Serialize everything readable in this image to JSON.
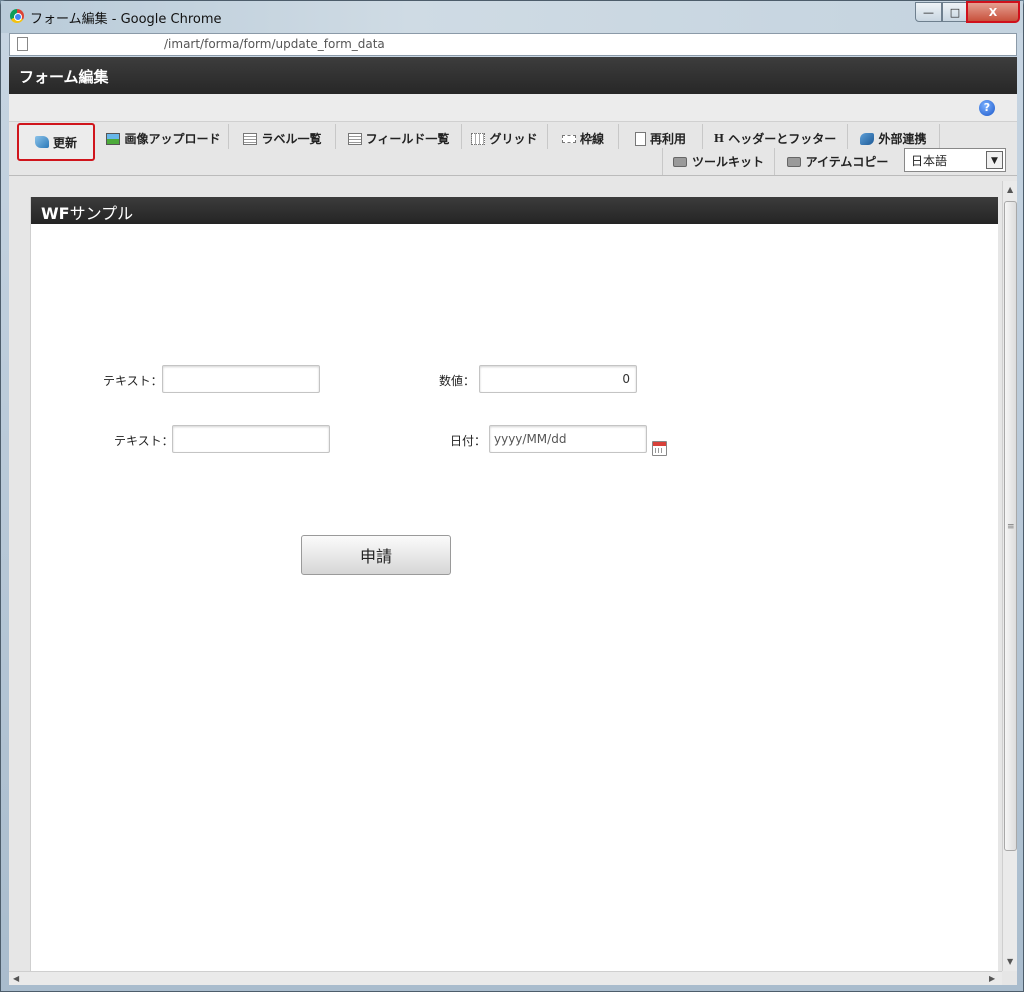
{
  "window": {
    "title": "フォーム編集 - Google Chrome",
    "minimize_label": "—",
    "maximize_label": "□",
    "close_label": "X"
  },
  "address_bar": {
    "url": "/imart/forma/form/update_form_data"
  },
  "app": {
    "header_title": "フォーム編集",
    "help_icon": "?"
  },
  "toolbar": {
    "row1": [
      {
        "label": "更新",
        "icon": "update-icon"
      },
      {
        "label": "画像アップロード",
        "icon": "image-icon"
      },
      {
        "label": "ラベル一覧",
        "icon": "list-icon"
      },
      {
        "label": "フィールド一覧",
        "icon": "list-icon"
      },
      {
        "label": "グリッド",
        "icon": "grid-icon"
      },
      {
        "label": "枠線",
        "icon": "frame-icon"
      },
      {
        "label": "再利用",
        "icon": "document-icon"
      },
      {
        "label": "ヘッダーとフッター",
        "icon": "header-icon",
        "icon_text": "H"
      },
      {
        "label": "外部連携",
        "icon": "external-link-icon"
      }
    ],
    "row2": [
      {
        "label": "ツールキット",
        "icon": "toolkit-icon"
      },
      {
        "label": "アイテムコピー",
        "icon": "toolkit-icon"
      }
    ],
    "language": "日本語"
  },
  "form": {
    "panel_title_bold": "WF",
    "panel_title_rest": "サンプル",
    "fields": {
      "text1_label": "テキスト：",
      "text1_value": "",
      "number_label": "数値：",
      "number_value": "0",
      "text2_label": "テキスト：",
      "text2_value": "",
      "date_label": "日付：",
      "date_placeholder": "yyyy/MM/dd"
    },
    "submit_label": "申請"
  },
  "colors": {
    "header_bg": "#2f2f2f",
    "highlight_red": "#d0151c",
    "content_bg": "#e6e6e6"
  }
}
